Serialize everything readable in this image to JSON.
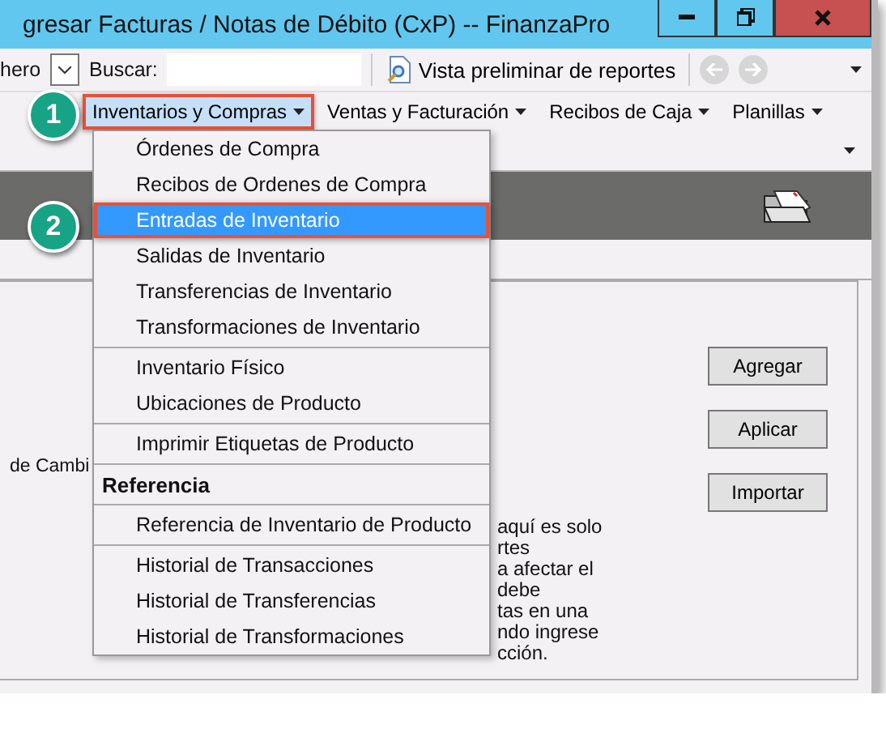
{
  "window": {
    "title": "gresar Facturas / Notas de Débito (CxP) -- FinanzaPro"
  },
  "toolbar": {
    "partial_label": "hero",
    "search_label": "Buscar:",
    "preview_button": "Vista preliminar de reportes"
  },
  "menubar": [
    {
      "label": "Inventarios y Compras",
      "selected": true
    },
    {
      "label": "Ventas y Facturación",
      "selected": false
    },
    {
      "label": "Recibos de Caja",
      "selected": false
    },
    {
      "label": "Planillas",
      "selected": false
    }
  ],
  "dropdown": [
    {
      "kind": "item",
      "label": "Órdenes de Compra",
      "selected": false
    },
    {
      "kind": "item",
      "label": "Recibos de Ordenes de Compra",
      "selected": false
    },
    {
      "kind": "item",
      "label": "Entradas de Inventario",
      "selected": true
    },
    {
      "kind": "item",
      "label": "Salidas de Inventario",
      "selected": false
    },
    {
      "kind": "item",
      "label": "Transferencias de Inventario",
      "selected": false
    },
    {
      "kind": "item",
      "label": "Transformaciones de Inventario",
      "selected": false
    },
    {
      "kind": "separator"
    },
    {
      "kind": "item",
      "label": "Inventario Físico",
      "selected": false
    },
    {
      "kind": "item",
      "label": "Ubicaciones de Producto",
      "selected": false
    },
    {
      "kind": "separator"
    },
    {
      "kind": "item",
      "label": "Imprimir Etiquetas de Producto",
      "selected": false
    },
    {
      "kind": "separator"
    },
    {
      "kind": "header",
      "label": "Referencia"
    },
    {
      "kind": "separator"
    },
    {
      "kind": "item",
      "label": "Referencia de Inventario de Producto",
      "selected": false
    },
    {
      "kind": "separator"
    },
    {
      "kind": "item",
      "label": "Historial de Transacciones",
      "selected": false
    },
    {
      "kind": "item",
      "label": "Historial de Transferencias",
      "selected": false
    },
    {
      "kind": "item",
      "label": "Historial de Transformaciones",
      "selected": false
    }
  ],
  "callouts": [
    "1",
    "2"
  ],
  "form": {
    "partial_label": "de Cambi",
    "buttons": [
      "Agregar",
      "Aplicar",
      "Importar"
    ],
    "note_fragments": [
      "aquí es solo",
      "rtes",
      "a afectar el",
      "debe",
      "tas en una",
      "ndo ingrese",
      "cción."
    ]
  }
}
